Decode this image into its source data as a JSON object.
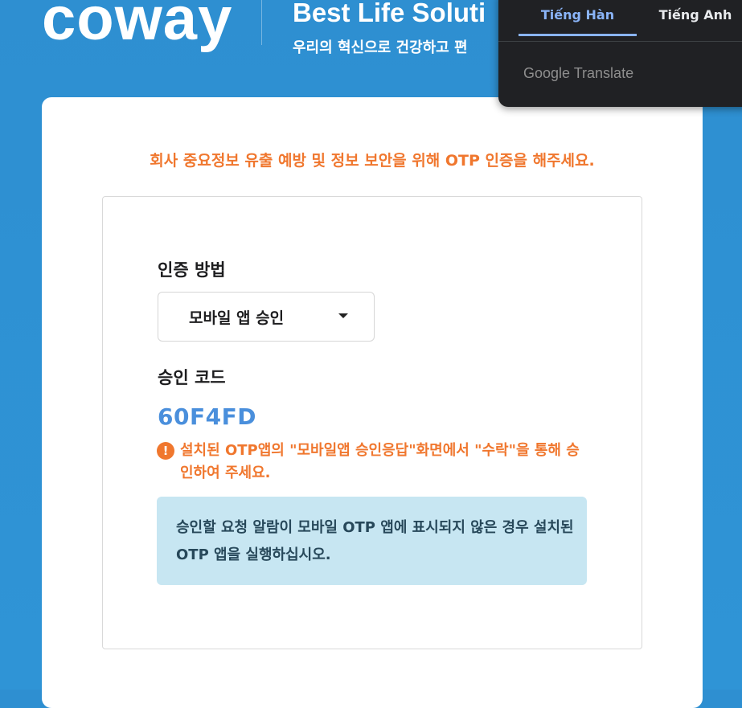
{
  "header": {
    "logo": "coway",
    "tagline": "Best Life Soluti",
    "subtagline": "우리의 혁신으로 건강하고 편"
  },
  "card": {
    "notice": "회사 중요정보 유출 예방 및 정보 보안을 위해 OTP 인증을 해주세요.",
    "auth_method_label": "인증 방법",
    "auth_method_selected": "모바일 앱 승인",
    "approval_code_label": "승인 코드",
    "approval_code": "60F4FD",
    "warning_icon_glyph": "!",
    "warning_text": "설치된 OTP앱의 \"모바일앱 승인응답\"화면에서 \"수락\"을 통해 승인하여 주세요.",
    "info_text": "승인할 요청 알람이 모바일 OTP 앱에 표시되지 않은 경우 설치된 OTP 앱을 실행하십시오."
  },
  "translate_popup": {
    "tabs": [
      {
        "label": "Tiếng Hàn",
        "active": true
      },
      {
        "label": "Tiếng Anh",
        "active": false
      }
    ],
    "brand": "Google Translate"
  },
  "colors": {
    "background": "#2e8fd1",
    "accent_orange": "#f0772e",
    "code_blue": "#4a8fdc",
    "info_bg": "#c7e6f2",
    "popup_bg": "#202124",
    "popup_active": "#8ab4f8"
  }
}
